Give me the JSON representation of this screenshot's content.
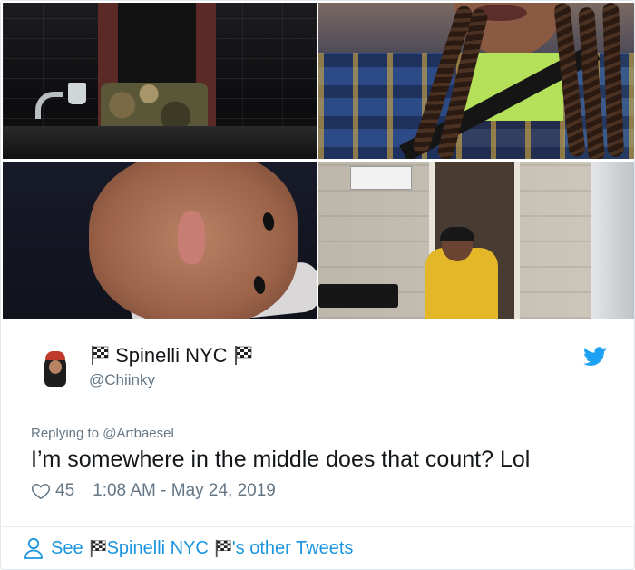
{
  "tweet": {
    "display_name": "Spinelli NYC",
    "handle": "@Chiinky",
    "replying_prefix": "Replying to ",
    "replying_to": "@Artbaesel",
    "text": "I’m somewhere in the middle does that count? Lol",
    "likes": "45",
    "timestamp": "1:08 AM - May 24, 2019"
  },
  "footer": {
    "see_label": "See",
    "name": "Spinelli NYC",
    "suffix": "'s other Tweets"
  },
  "icons": {
    "flag": "checkered-flag-icon",
    "bird": "twitter-bird-icon",
    "heart": "heart-icon",
    "person": "person-icon"
  },
  "colors": {
    "brand_blue": "#1da1f2",
    "link_blue": "#1b95e0",
    "secondary_text": "#657786",
    "primary_text": "#14171a",
    "border": "#e1e8ed"
  }
}
